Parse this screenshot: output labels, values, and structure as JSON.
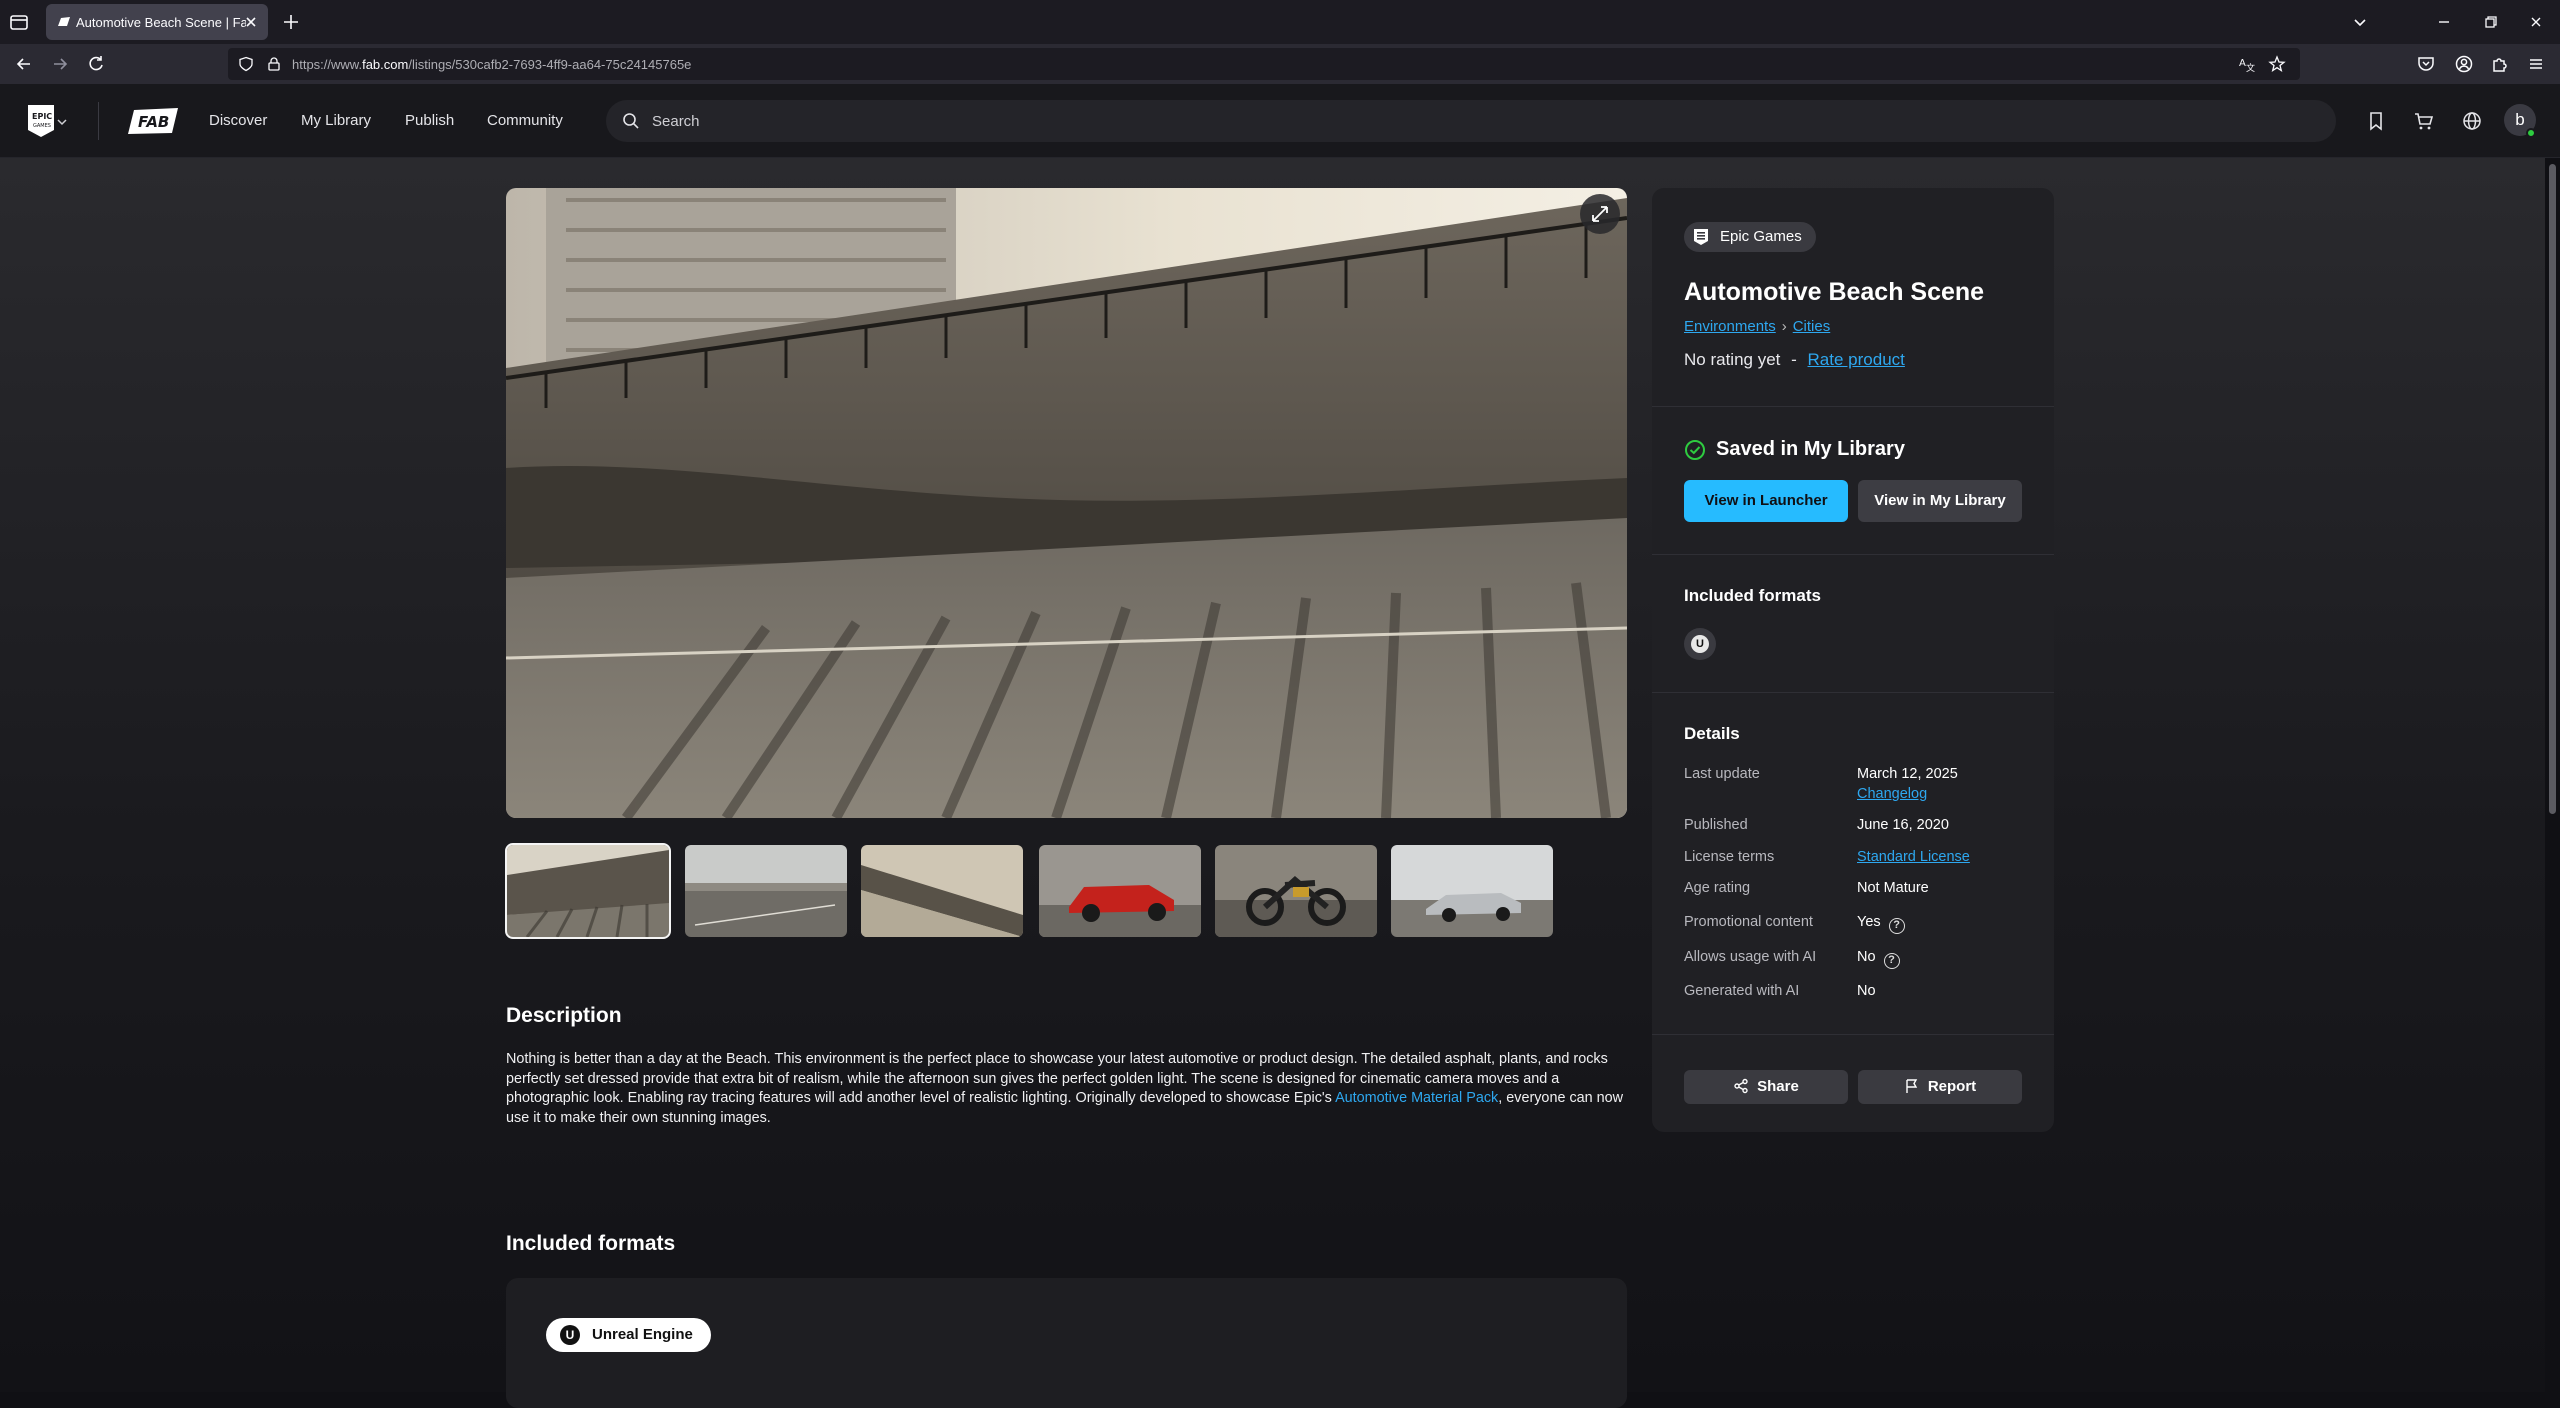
{
  "browser": {
    "tab_title": "Automotive Beach Scene | Fab",
    "url_prefix": "https://www.",
    "url_domain": "fab.com",
    "url_path": "/listings/530cafb2-7693-4ff9-aa64-75c24145765e"
  },
  "header": {
    "menu": [
      "Discover",
      "My Library",
      "Publish",
      "Community"
    ],
    "search_placeholder": "Search",
    "avatar_initial": "b"
  },
  "product": {
    "publisher": "Epic Games",
    "title": "Automotive Beach Scene",
    "breadcrumb": [
      "Environments",
      "Cities"
    ],
    "rating_text": "No rating yet",
    "rating_sep": "-",
    "rate_link": "Rate product"
  },
  "library": {
    "status": "Saved in My Library",
    "launcher_button": "View in Launcher",
    "library_button": "View in My Library"
  },
  "formats_heading": "Included formats",
  "details": {
    "heading": "Details",
    "rows": [
      {
        "label": "Last update",
        "value": "March 12, 2025",
        "link": "Changelog"
      },
      {
        "label": "Published",
        "value": "June 16, 2020"
      },
      {
        "label": "License terms",
        "link": "Standard License"
      },
      {
        "label": "Age rating",
        "value": "Not Mature"
      },
      {
        "label": "Promotional content",
        "value": "Yes"
      },
      {
        "label": "Allows usage with AI",
        "value": "No"
      },
      {
        "label": "Generated with AI",
        "value": "No"
      }
    ]
  },
  "actions": {
    "share": "Share",
    "report": "Report"
  },
  "description": {
    "heading": "Description",
    "text": "Nothing is better than a day at the Beach. This environment is the perfect place to showcase your latest automotive or product design. The detailed asphalt, plants, and rocks perfectly set dressed provide that extra bit of realism, while the afternoon sun gives the perfect golden light. The scene is designed for cinematic camera moves and a photographic look. Enabling ray tracing features will add another level of realistic lighting. Originally developed to showcase Epic's ",
    "link": "Automotive Material Pack",
    "text_end": ", everyone can now use it to make their own stunning images."
  },
  "included_formats": {
    "heading": "Included formats",
    "engine": "Unreal Engine"
  },
  "colors": {
    "accent": "#26bbff",
    "link": "#2ea8f0",
    "success": "#2ecc40"
  }
}
